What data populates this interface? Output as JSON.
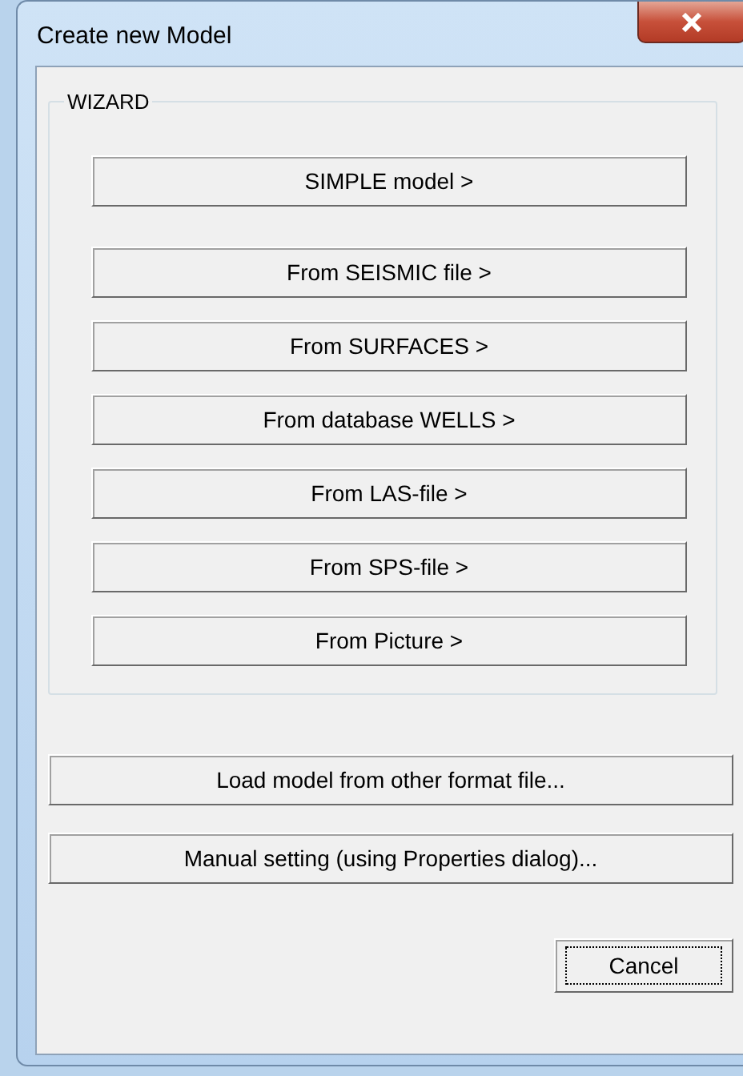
{
  "window": {
    "title": "Create new Model"
  },
  "wizard": {
    "label": "WIZARD",
    "buttons": [
      {
        "label": "SIMPLE model >"
      },
      {
        "label": "From SEISMIC file >"
      },
      {
        "label": "From SURFACES >"
      },
      {
        "label": "From database WELLS >"
      },
      {
        "label": "From LAS-file >"
      },
      {
        "label": "From SPS-file >"
      },
      {
        "label": "From Picture >"
      }
    ]
  },
  "actions": [
    {
      "label": "Load model from other format file..."
    },
    {
      "label": "Manual setting (using Properties dialog)..."
    }
  ],
  "footer_buttons": [
    {
      "label": "Cancel",
      "focused": true
    }
  ]
}
